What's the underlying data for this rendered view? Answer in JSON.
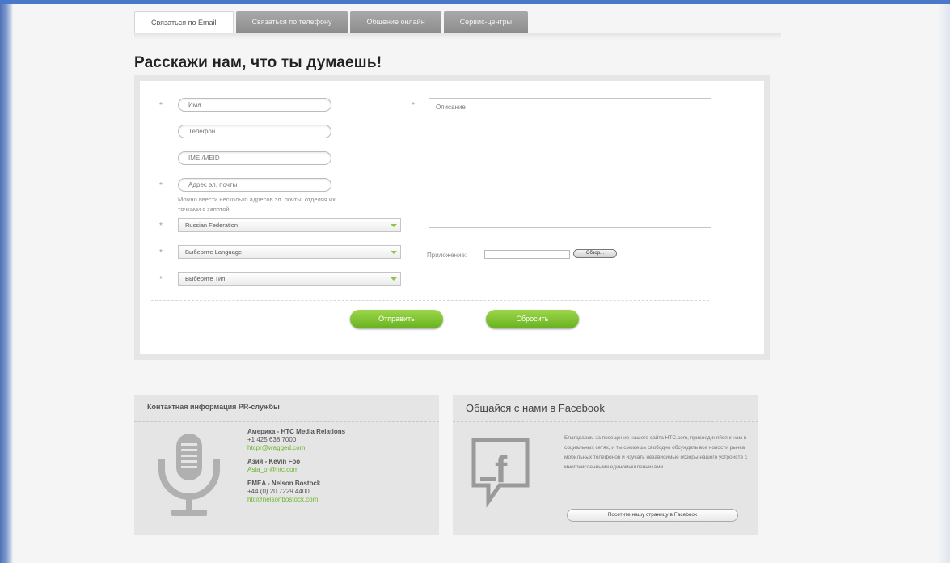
{
  "tabs": [
    {
      "label": "Связаться по Email",
      "active": true
    },
    {
      "label": "Связаться по телефону",
      "active": false
    },
    {
      "label": "Общение онлайн",
      "active": false
    },
    {
      "label": "Сервис-центры",
      "active": false
    }
  ],
  "page_title": "Расскажи нам, что ты думаешь!",
  "form": {
    "required_mark": "*",
    "name_placeholder": "Имя",
    "phone_placeholder": "Телефон",
    "imei_placeholder": "IMEI/MEID",
    "email_placeholder": "Адрес эл. почты",
    "email_hint": "Можно ввести несколько адресов эл. почты, отделяя их точками с запятой",
    "country_value": "Russian Federation",
    "language_value": "Выберите Language",
    "type_value": "Выберите Тип",
    "description_placeholder": "Описание",
    "attachment_label": "Приложение:",
    "browse_label": "Обзор...",
    "submit_label": "Отправить",
    "reset_label": "Сбросить"
  },
  "pr_panel": {
    "title": "Контактная информация PR-службы",
    "icon": "microphone-icon",
    "contacts": [
      {
        "region": "Америка - HTC Media Relations",
        "phone": "+1 425 638 7000",
        "email": "htcpr@wagged.com"
      },
      {
        "region": "Азия - Kevin Foo",
        "email": "Asia_pr@htc.com"
      },
      {
        "region": "EMEA - Nelson Bostock",
        "phone": "+44 (0) 20 7229 4400",
        "email": "htc@nelsonbostock.com"
      }
    ]
  },
  "fb_panel": {
    "title": "Общайся с нами в Facebook",
    "icon": "facebook-icon",
    "text": "Благодарим за посещение нашего сайта HTC.com, присоединяйся к нам в социальных сетях, и ты сможешь свободно обсуждать все новости рынка мобильных телефонов и изучать независимые обзоры нашего устройств с многочисленными единомышленниками.",
    "button_label": "Посетите нашу страницу в Facebook"
  },
  "colors": {
    "accent_green": "#6cb52b",
    "frame_blue": "#4a78c8"
  }
}
